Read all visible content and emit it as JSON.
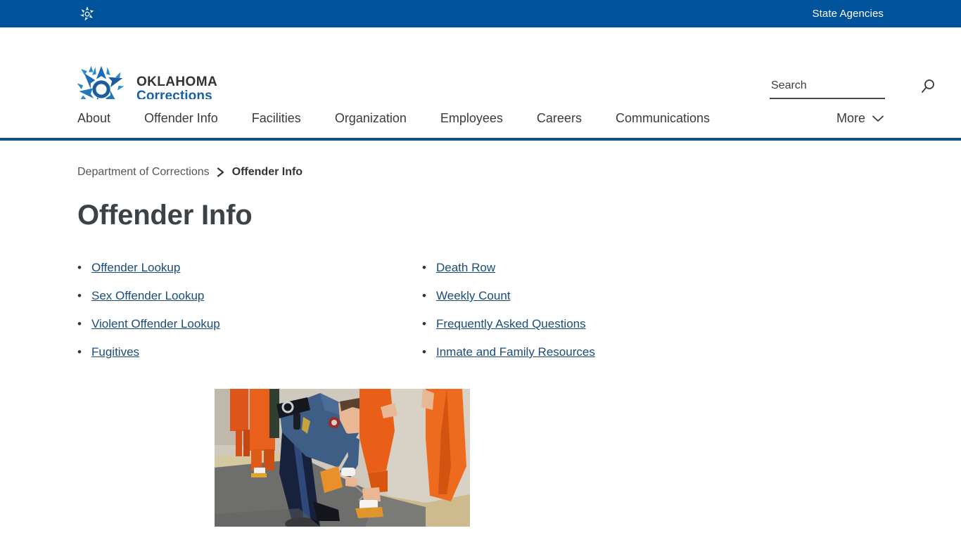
{
  "topbar": {
    "logo_icon": "oklahoma-star-icon",
    "links": [
      {
        "label": "State Agencies"
      }
    ]
  },
  "header": {
    "brand": {
      "icon": "oklahoma-star-logo",
      "line1": "OKLAHOMA",
      "line2": "Corrections"
    },
    "search": {
      "placeholder": "Search",
      "value": "",
      "icon": "search-icon"
    }
  },
  "nav": {
    "items": [
      {
        "label": "About"
      },
      {
        "label": "Offender Info"
      },
      {
        "label": "Facilities"
      },
      {
        "label": "Organization"
      },
      {
        "label": "Employees"
      },
      {
        "label": "Careers"
      },
      {
        "label": "Communications"
      }
    ],
    "more": {
      "label": "More",
      "icon": "chevron-down-icon"
    }
  },
  "breadcrumb": {
    "parent": "Department of Corrections",
    "separator": "›",
    "current": "Offender Info"
  },
  "page": {
    "title": "Offender Info"
  },
  "links": {
    "bullet": "•",
    "left": [
      {
        "label": "Offender Lookup"
      },
      {
        "label": "Sex Offender Lookup"
      },
      {
        "label": "Violent Offender Lookup"
      },
      {
        "label": "Fugitives"
      }
    ],
    "right": [
      {
        "label": "Death Row"
      },
      {
        "label": "Weekly Count"
      },
      {
        "label": "Frequently Asked Questions"
      },
      {
        "label": "Inmate and Family Resources"
      }
    ]
  },
  "photo": {
    "alt": "Corrections officer applying leg restraints to inmates in orange jumpsuits"
  },
  "colors": {
    "topbar_blue": "#00529B",
    "nav_border_blue": "#13507E",
    "brand_blue": "#1B5FA8",
    "link_blue": "#1B4C78",
    "title_gray": "#3d4246"
  }
}
